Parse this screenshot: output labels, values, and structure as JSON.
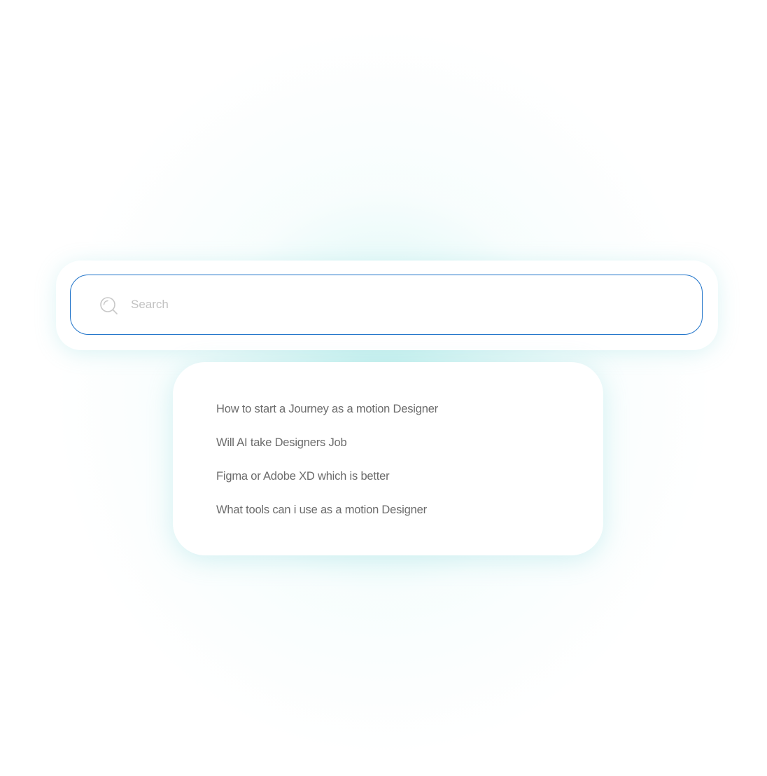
{
  "search": {
    "placeholder": "Search",
    "value": "",
    "icon": "search-icon",
    "border_color": "#1f73c9"
  },
  "suggestions": {
    "items": [
      {
        "label": "How to start a Journey as a motion Designer"
      },
      {
        "label": "Will AI take Designers Job"
      },
      {
        "label": "Figma or Adobe XD which is better"
      },
      {
        "label": "What tools can i use as a motion Designer"
      }
    ]
  },
  "colors": {
    "glow": "#a0e8e4",
    "text": "#6b6b6b",
    "placeholder": "#c2c2c2"
  }
}
